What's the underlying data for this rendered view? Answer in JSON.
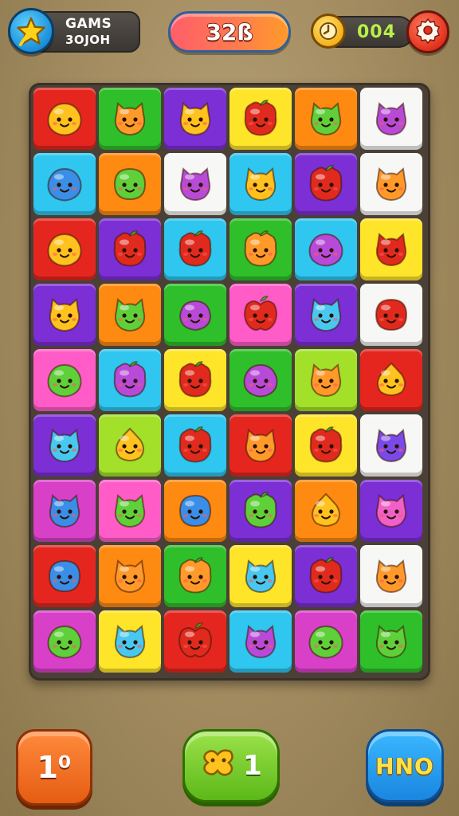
{
  "hud": {
    "title_line1": "GAMS",
    "title_line2": "3OJOH",
    "score": "32ß",
    "timer": "004",
    "star_icon": "star-icon",
    "clock_icon": "clock-icon",
    "gear_icon": "gear-icon"
  },
  "board": {
    "columns": 6,
    "rows": 9,
    "tiles": [
      [
        "red",
        "yellow",
        "lemon"
      ],
      [
        "green",
        "orange",
        "cat"
      ],
      [
        "purple",
        "yellow",
        "cat"
      ],
      [
        "yellow",
        "red",
        "berry"
      ],
      [
        "orange",
        "green",
        "cat"
      ],
      [
        "white",
        "violet",
        "cat"
      ],
      [
        "cyan",
        "blue",
        "lemon"
      ],
      [
        "orange",
        "green",
        "round"
      ],
      [
        "white",
        "violet",
        "cat"
      ],
      [
        "cyan",
        "yellow",
        "cat"
      ],
      [
        "purple",
        "red",
        "berry"
      ],
      [
        "white",
        "orange",
        "cat"
      ],
      [
        "red",
        "yellow",
        "lemon"
      ],
      [
        "purple",
        "red",
        "berry"
      ],
      [
        "cyan",
        "red",
        "berry"
      ],
      [
        "green",
        "orange",
        "berry"
      ],
      [
        "cyan",
        "violet",
        "lemon"
      ],
      [
        "yellow",
        "red",
        "cat"
      ],
      [
        "purple",
        "yellow",
        "cat"
      ],
      [
        "orange",
        "green",
        "cat"
      ],
      [
        "green",
        "violet",
        "plum"
      ],
      [
        "pink",
        "red",
        "apple"
      ],
      [
        "purple",
        "sky",
        "cat"
      ],
      [
        "white",
        "red",
        "round"
      ],
      [
        "pink",
        "green",
        "lemon"
      ],
      [
        "cyan",
        "violet",
        "berry"
      ],
      [
        "yellow",
        "red",
        "berry"
      ],
      [
        "green",
        "violet",
        "lemon"
      ],
      [
        "lime",
        "orange",
        "cat"
      ],
      [
        "red",
        "yellow",
        "drop"
      ],
      [
        "purple",
        "sky",
        "cat"
      ],
      [
        "lime",
        "yellow",
        "drop"
      ],
      [
        "cyan",
        "red",
        "berry"
      ],
      [
        "red",
        "orange",
        "cat"
      ],
      [
        "yellow",
        "red",
        "berry"
      ],
      [
        "white",
        "indigo",
        "cat"
      ],
      [
        "magenta",
        "blue",
        "cat"
      ],
      [
        "pink",
        "green",
        "cat"
      ],
      [
        "orange",
        "blue",
        "round"
      ],
      [
        "purple",
        "green",
        "berry"
      ],
      [
        "orange",
        "yellow",
        "drop"
      ],
      [
        "purple",
        "pink",
        "cat"
      ],
      [
        "red",
        "blue",
        "round"
      ],
      [
        "orange",
        "orange",
        "cat"
      ],
      [
        "green",
        "orange",
        "berry"
      ],
      [
        "yellow",
        "sky",
        "cat"
      ],
      [
        "purple",
        "red",
        "berry"
      ],
      [
        "white",
        "orange",
        "cat"
      ],
      [
        "magenta",
        "green",
        "lemon"
      ],
      [
        "yellow",
        "sky",
        "cat"
      ],
      [
        "red",
        "red",
        "apple"
      ],
      [
        "cyan",
        "violet",
        "cat"
      ],
      [
        "magenta",
        "green",
        "lemon"
      ],
      [
        "green",
        "green",
        "cat"
      ]
    ]
  },
  "colors": {
    "tile_bg": {
      "red": "#e5261f",
      "green": "#2fbf2a",
      "purple": "#7b2fd4",
      "yellow": "#ffe52a",
      "orange": "#ff8a12",
      "white": "#f7f7f5",
      "cyan": "#2fc6ef",
      "pink": "#ff5cc8",
      "lime": "#a2e02a",
      "magenta": "#d840c8"
    },
    "character": {
      "yellow": "#ffc21e",
      "orange": "#ff9a2a",
      "red": "#e02a1e",
      "green": "#5fd03a",
      "violet": "#b84ad8",
      "blue": "#3a8ee8",
      "sky": "#48c8f0",
      "pink": "#f060c8",
      "indigo": "#7a4ae8"
    }
  },
  "buttons": {
    "left_label": "1⁰",
    "mid_count": "1",
    "right_label": "HNO"
  }
}
